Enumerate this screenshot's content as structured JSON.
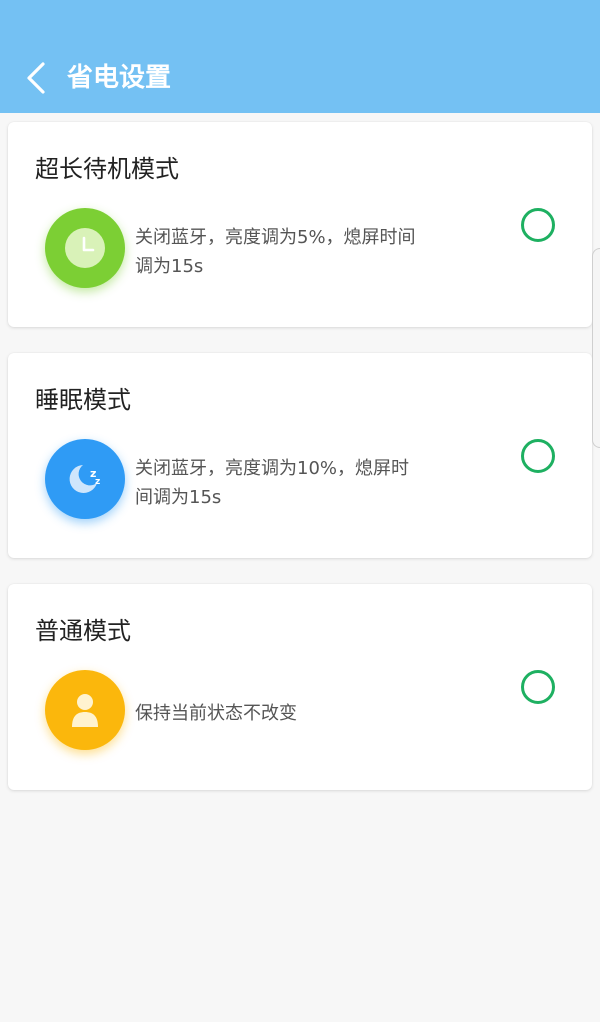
{
  "header": {
    "title": "省电设置",
    "background": "#74c1f3",
    "back_icon": "chevron-left-icon"
  },
  "modes": [
    {
      "title": "超长待机模式",
      "description_line1": "关闭蓝牙，亮度调为5%，熄屏时间",
      "description_line2": "调为15s",
      "icon": "clock-icon",
      "icon_color": "#7ccf34",
      "selected": false
    },
    {
      "title": "睡眠模式",
      "description_line1": "关闭蓝牙，亮度调为10%，熄屏时",
      "description_line2": "间调为15s",
      "icon": "moon-sleep-icon",
      "icon_color": "#2f9bf5",
      "selected": false
    },
    {
      "title": "普通模式",
      "description_line1": "保持当前状态不改变",
      "description_line2": "",
      "icon": "person-icon",
      "icon_color": "#fbb70c",
      "selected": false
    }
  ],
  "colors": {
    "radio_ring": "#1eb061",
    "page_background": "#f7f7f7"
  }
}
